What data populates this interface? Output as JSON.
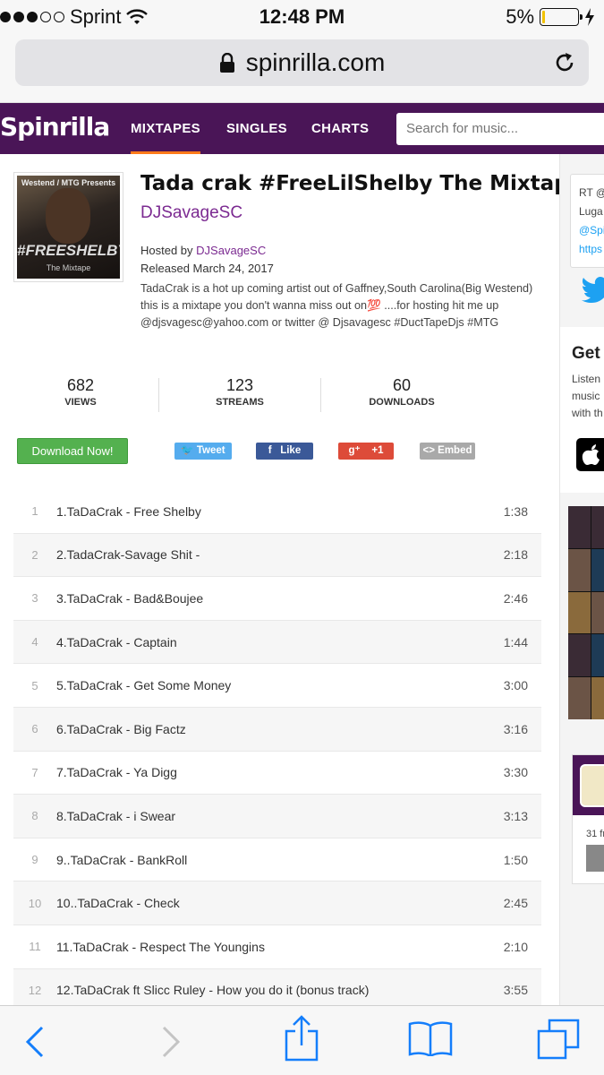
{
  "status_bar": {
    "carrier": "Sprint",
    "time": "12:48 PM",
    "battery": "5%",
    "battery_level": 0.05
  },
  "browser": {
    "url": "spinrilla.com"
  },
  "site_nav": {
    "logo": "Spinrilla",
    "items": [
      "MIXTAPES",
      "SINGLES",
      "CHARTS"
    ],
    "active": "MIXTAPES",
    "search_placeholder": "Search for music..."
  },
  "mixtape": {
    "cover": {
      "top_text": "Westend / MTG Presents",
      "main_text": "#FREESHELBY",
      "sub_text": "The Mixtape"
    },
    "title": "Tada crak #FreeLilShelby The Mixtape",
    "artist": "DJSavageSC",
    "hosted_label": "Hosted by",
    "hosted_by": "DJSavageSC",
    "released": "Released March 24, 2017",
    "description": "TadaCrak is a hot up coming artist out of Gaffney,South Carolina(Big Westend) this is a mixtape you don't wanna miss out on💯 ....for hosting hit me up @djsvagesc@yahoo.com or twitter @ Djsavagesc #DuctTapeDjs #MTG",
    "stats": [
      {
        "value": "682",
        "label": "VIEWS"
      },
      {
        "value": "123",
        "label": "STREAMS"
      },
      {
        "value": "60",
        "label": "DOWNLOADS"
      }
    ],
    "download_label": "Download Now!",
    "share": {
      "tweet": "Tweet",
      "like": "Like",
      "plus": "+1",
      "embed": "<> Embed"
    }
  },
  "tracks": [
    {
      "num": "1",
      "name": "1.TaDaCrak - Free Shelby",
      "duration": "1:38"
    },
    {
      "num": "2",
      "name": "2.TadaCrak-Savage Shit -",
      "duration": "2:18"
    },
    {
      "num": "3",
      "name": "3.TaDaCrak - Bad&Boujee",
      "duration": "2:46"
    },
    {
      "num": "4",
      "name": "4.TaDaCrak - Captain",
      "duration": "1:44"
    },
    {
      "num": "5",
      "name": "5.TaDaCrak - Get Some Money",
      "duration": "3:00"
    },
    {
      "num": "6",
      "name": "6.TaDaCrak - Big Factz",
      "duration": "3:16"
    },
    {
      "num": "7",
      "name": "7.TaDaCrak - Ya Digg",
      "duration": "3:30"
    },
    {
      "num": "8",
      "name": "8.TaDaCrak - i Swear",
      "duration": "3:13"
    },
    {
      "num": "9",
      "name": "9..TaDaCrak - BankRoll",
      "duration": "1:50"
    },
    {
      "num": "10",
      "name": "10..TaDaCrak - Check",
      "duration": "2:45"
    },
    {
      "num": "11",
      "name": "11.TaDaCrak - Respect The Youngins",
      "duration": "2:10"
    },
    {
      "num": "12",
      "name": "12.TaDaCrak ft Slicc Ruley - How you do it (bonus track)",
      "duration": "3:55"
    }
  ],
  "sidebar": {
    "tweet_lines": [
      "RT @",
      "Luga",
      "@Spi",
      "https"
    ],
    "get_title": "Get",
    "get_lines": [
      "Listen",
      "music",
      "with th"
    ],
    "fb_count": "31 fr"
  },
  "icons": {
    "back": "chevron-left-icon",
    "forward": "chevron-right-icon",
    "share": "share-icon",
    "bookmarks": "book-icon",
    "tabs": "tabs-icon"
  },
  "colors": {
    "nav_bg": "#4a1557",
    "accent": "#7b2a91",
    "active_underline": "#ff7a1a",
    "download_green": "#54b14f",
    "ios_blue": "#147efb"
  }
}
